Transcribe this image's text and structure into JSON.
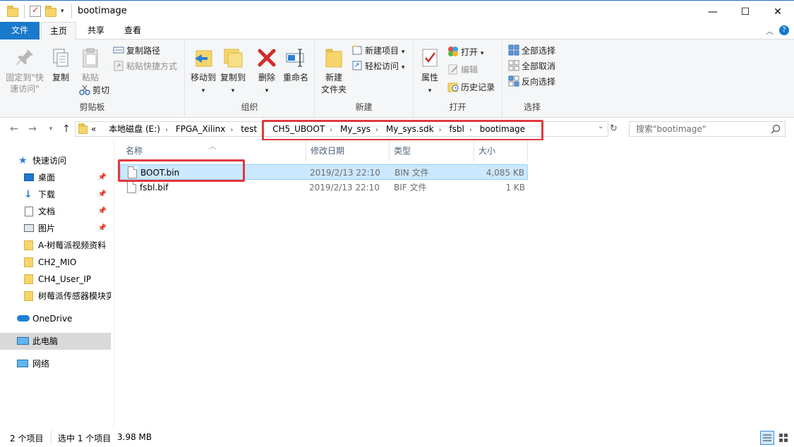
{
  "window": {
    "title": "bootimage",
    "minimize_glyph": "—",
    "maximize_glyph": "☐",
    "close_glyph": "✕"
  },
  "tabs": [
    {
      "label": "文件"
    },
    {
      "label": "主页"
    },
    {
      "label": "共享"
    },
    {
      "label": "查看"
    }
  ],
  "ribbon": {
    "clipboard": {
      "label": "剪贴板",
      "pin_quick_access": "固定到\"快速访问\"",
      "copy": "复制",
      "paste": "粘贴",
      "copy_path": "复制路径",
      "paste_shortcut": "粘贴快捷方式",
      "cut": "剪切"
    },
    "organize": {
      "label": "组织",
      "move_to": "移动到",
      "copy_to": "复制到",
      "delete": "删除",
      "rename": "重命名"
    },
    "new": {
      "label": "新建",
      "new_folder_line1": "新建",
      "new_folder_line2": "文件夹",
      "new_item": "新建项目",
      "easy_access": "轻松访问"
    },
    "open": {
      "label": "打开",
      "properties": "属性",
      "open": "打开",
      "edit": "编辑",
      "history": "历史记录"
    },
    "select": {
      "label": "选择",
      "select_all": "全部选择",
      "select_none": "全部取消",
      "invert": "反向选择"
    }
  },
  "address": {
    "prefix": "«",
    "crumbs": [
      "本地磁盘 (E:)",
      "FPGA_Xilinx",
      "test",
      "CH5_UBOOT",
      "My_sys",
      "My_sys.sdk",
      "fsbl",
      "bootimage"
    ],
    "search_placeholder": "搜索\"bootimage\""
  },
  "nav": {
    "quick_access": "快速访问",
    "items": [
      "桌面",
      "下载",
      "文档",
      "图片",
      "A-树莓派视频资料",
      "CH2_MIO",
      "CH4_User_IP",
      "树莓派传感器模块实"
    ],
    "onedrive": "OneDrive",
    "this_pc": "此电脑",
    "network": "网络"
  },
  "columns": [
    "名称",
    "修改日期",
    "类型",
    "大小"
  ],
  "files": [
    {
      "name": "BOOT.bin",
      "date": "2019/2/13 22:10",
      "type": "BIN 文件",
      "size": "4,085 KB"
    },
    {
      "name": "fsbl.bif",
      "date": "2019/2/13 22:10",
      "type": "BIF 文件",
      "size": "1 KB"
    }
  ],
  "status": {
    "count": "2 个项目",
    "selected": "选中 1 个项目",
    "size": "3.98 MB"
  },
  "colors": {
    "accent": "#1979ca",
    "highlight": "#e0393e",
    "selection": "#cce8ff"
  }
}
